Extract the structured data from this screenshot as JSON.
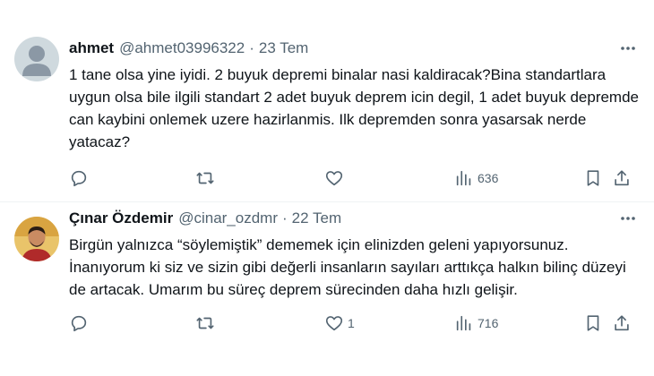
{
  "tweets": [
    {
      "name": "ahmet",
      "handle": "@ahmet03996322",
      "separator": "·",
      "date": "23 Tem",
      "text": "1 tane olsa yine iyidi. 2 buyuk depremi binalar nasi kaldiracak?Bina standartlara uygun olsa bile ilgili standart 2 adet buyuk deprem icin degil, 1 adet buyuk depremde can kaybini onlemek uzere hazirlanmis. Ilk depremden sonra yasarsak nerde yatacaz?",
      "likes": "",
      "views": "636",
      "avatar": "default-avatar"
    },
    {
      "name": "Çınar Özdemir",
      "handle": "@cinar_ozdmr",
      "separator": "·",
      "date": "22 Tem",
      "text": "Birgün yalnızca “söylemiştik” dememek için elinizden geleni yapıyorsunuz. İnanıyorum ki siz ve sizin gibi değerli insanların sayıları arttıkça halkın bilinç düzeyi de artacak. Umarım bu süreç deprem sürecinden daha hızlı gelişir.",
      "likes": "1",
      "views": "716",
      "avatar": "profile-photo"
    }
  ],
  "icons": [
    "more-icon",
    "reply-icon",
    "retweet-icon",
    "like-icon",
    "views-icon",
    "bookmark-icon",
    "share-icon"
  ],
  "colors": {
    "text": "#0f1419",
    "muted": "#536471",
    "divider": "#eff3f4",
    "avatar_default": "#cfd9de"
  }
}
